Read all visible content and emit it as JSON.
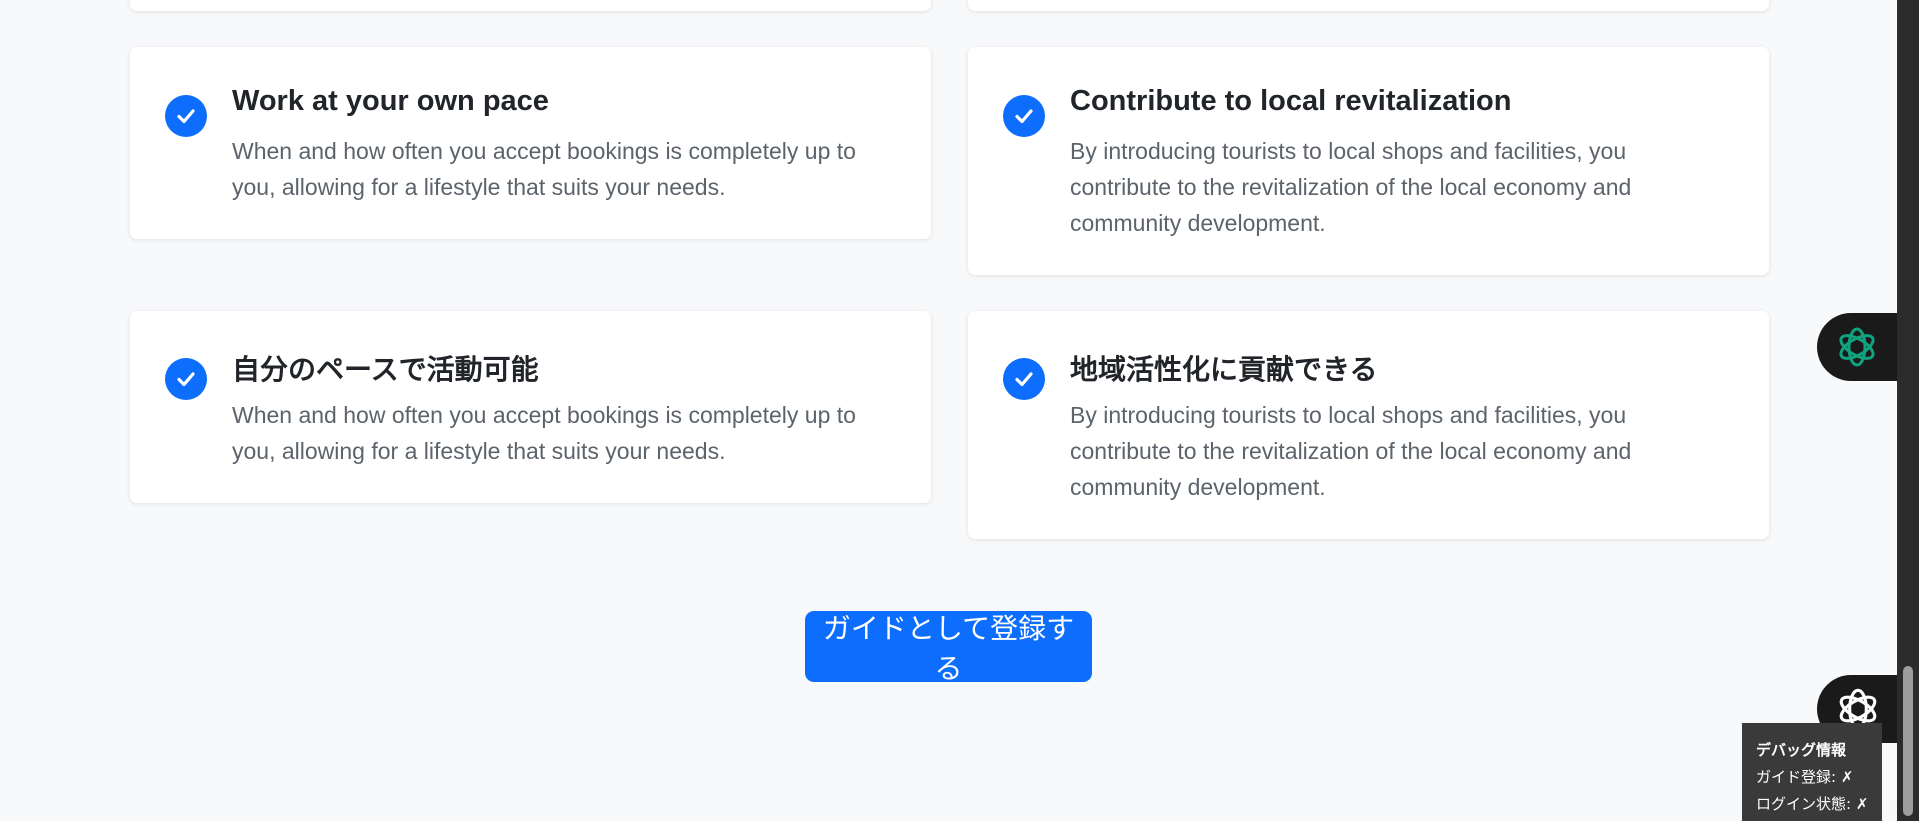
{
  "cards": [
    {
      "title": "Work at your own pace",
      "lines": [
        "When and how often you accept bookings is completely up to",
        "you, allowing for a lifestyle that suits your needs."
      ]
    },
    {
      "title": "Contribute to local revitalization",
      "lines": [
        "By introducing tourists to local shops and facilities, you",
        "contribute to the revitalization of the local economy and",
        "community development."
      ]
    },
    {
      "title": "自分のペースで活動可能",
      "lines": [
        "When and how often you accept bookings is completely up to",
        "you, allowing for a lifestyle that suits your needs."
      ]
    },
    {
      "title": "地域活性化に貢献できる",
      "lines": [
        "By introducing tourists to local shops and facilities, you",
        "contribute to the revitalization of the local economy and",
        "community development."
      ]
    }
  ],
  "register_button": {
    "label": "ガイドとして登録する"
  },
  "debug": {
    "title": "デバッグ情報",
    "guide_registration": "ガイド登録: ✗",
    "login_state": "ログイン状態: ✗"
  },
  "icons": {
    "card_check": "check-circle-icon",
    "assistant_top": "openai-logo-icon",
    "assistant_bottom": "ai-assistant-icon"
  },
  "colors": {
    "accent": "#0d6efd",
    "background": "#f8f9fa",
    "heading": "#212529",
    "body_text": "#5c636a",
    "assistant_logo": "#10a37f",
    "debug_bg": "#3a3a3a"
  }
}
